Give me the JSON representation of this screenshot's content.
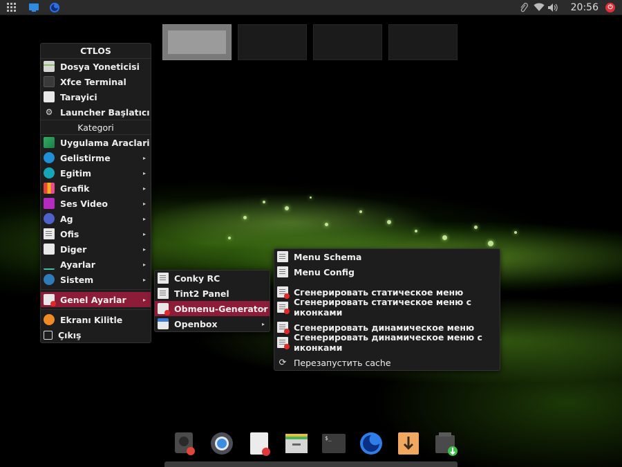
{
  "top_panel": {
    "clock": "20:56",
    "icons": [
      "apps-grid-icon",
      "desktop-icon",
      "firefox-icon",
      "paperclip-icon",
      "wifi-icon",
      "volume-icon",
      "power-icon"
    ]
  },
  "workspaces": {
    "count": 4,
    "active_index": 0
  },
  "main_menu": {
    "title": "CTLOS",
    "favorites": [
      {
        "label": "Dosya Yoneticisi",
        "icon": "file-manager-icon"
      },
      {
        "label": "Xfce Terminal",
        "icon": "terminal-icon"
      },
      {
        "label": "Tarayici",
        "icon": "browser-icon"
      },
      {
        "label": "Launcher Başlatıcı",
        "icon": "gears-icon"
      }
    ],
    "category_header": "Kategori",
    "categories": [
      {
        "label": "Uygulama Araclari",
        "icon": "accessories-icon"
      },
      {
        "label": "Gelistirme",
        "icon": "development-icon"
      },
      {
        "label": "Egitim",
        "icon": "education-icon"
      },
      {
        "label": "Grafik",
        "icon": "graphics-icon"
      },
      {
        "label": "Ses Video",
        "icon": "multimedia-icon"
      },
      {
        "label": "Ag",
        "icon": "network-icon"
      },
      {
        "label": "Ofis",
        "icon": "office-icon"
      },
      {
        "label": "Diger",
        "icon": "other-icon"
      },
      {
        "label": "Ayarlar",
        "icon": "settings-icon"
      },
      {
        "label": "Sistem",
        "icon": "system-icon"
      }
    ],
    "genel_ayarlar": "Genel Ayarlar",
    "lock": "Ekranı Kilitle",
    "exit": "Çıkış"
  },
  "submenu_genel": {
    "items": [
      {
        "label": "Conky RC"
      },
      {
        "label": "Tint2 Panel"
      },
      {
        "label": "Obmenu-Generator"
      },
      {
        "label": "Openbox"
      }
    ]
  },
  "submenu_obmenu": {
    "schema": "Menu Schema",
    "config": "Menu Config",
    "static": "Сгенерировать статическое меню",
    "static_icons": "Сгенерировать статическое меню с иконками",
    "dynamic": "Сгенерировать динамическое меню",
    "dynamic_icons": "Сгенерировать динамическое меню с иконками",
    "restart_cache": "Перезапустить cache"
  },
  "dock": [
    "disk-settings-icon",
    "chromium-icon",
    "text-editor-icon",
    "file-manager-icon",
    "terminal-icon",
    "firefox-icon",
    "download-icon",
    "install-icon"
  ],
  "colors": {
    "accent": "#8c1c37",
    "menu_bg": "#1d1d1d",
    "panel_bg": "#2b2b2b"
  }
}
